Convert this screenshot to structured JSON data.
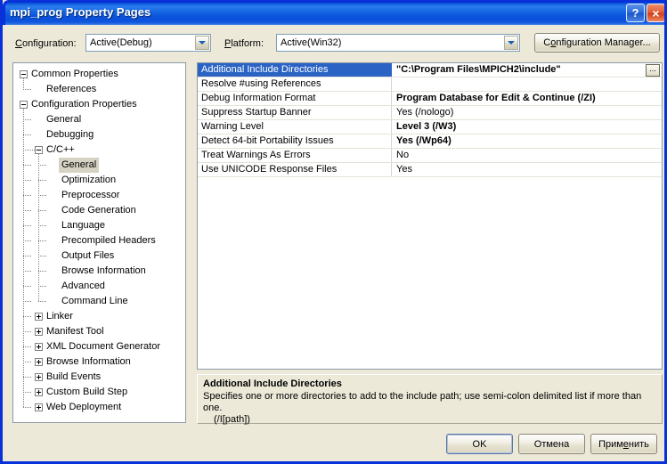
{
  "window": {
    "title": "mpi_prog Property Pages",
    "help_button": "?",
    "close_button": "×"
  },
  "toolbar": {
    "configuration_label": "Configuration:",
    "configuration_label_accel": "C",
    "configuration_value": "Active(Debug)",
    "platform_label": "Platform:",
    "platform_label_accel": "P",
    "platform_value": "Active(Win32)",
    "configuration_manager_label": "Configuration Manager...",
    "configuration_manager_accel": "o"
  },
  "tree": {
    "items": [
      {
        "label": "Common Properties",
        "level": 0,
        "toggle": "minus",
        "selected": false
      },
      {
        "label": "References",
        "level": 1,
        "toggle": "none",
        "selected": false
      },
      {
        "label": "Configuration Properties",
        "level": 0,
        "toggle": "minus",
        "selected": false
      },
      {
        "label": "General",
        "level": 1,
        "toggle": "none",
        "selected": false
      },
      {
        "label": "Debugging",
        "level": 1,
        "toggle": "none",
        "selected": false
      },
      {
        "label": "C/C++",
        "level": 1,
        "toggle": "minus",
        "selected": false
      },
      {
        "label": "General",
        "level": 2,
        "toggle": "none",
        "selected": true
      },
      {
        "label": "Optimization",
        "level": 2,
        "toggle": "none",
        "selected": false
      },
      {
        "label": "Preprocessor",
        "level": 2,
        "toggle": "none",
        "selected": false
      },
      {
        "label": "Code Generation",
        "level": 2,
        "toggle": "none",
        "selected": false
      },
      {
        "label": "Language",
        "level": 2,
        "toggle": "none",
        "selected": false
      },
      {
        "label": "Precompiled Headers",
        "level": 2,
        "toggle": "none",
        "selected": false
      },
      {
        "label": "Output Files",
        "level": 2,
        "toggle": "none",
        "selected": false
      },
      {
        "label": "Browse Information",
        "level": 2,
        "toggle": "none",
        "selected": false
      },
      {
        "label": "Advanced",
        "level": 2,
        "toggle": "none",
        "selected": false
      },
      {
        "label": "Command Line",
        "level": 2,
        "toggle": "none",
        "selected": false
      },
      {
        "label": "Linker",
        "level": 1,
        "toggle": "plus",
        "selected": false
      },
      {
        "label": "Manifest Tool",
        "level": 1,
        "toggle": "plus",
        "selected": false
      },
      {
        "label": "XML Document Generator",
        "level": 1,
        "toggle": "plus",
        "selected": false
      },
      {
        "label": "Browse Information",
        "level": 1,
        "toggle": "plus",
        "selected": false
      },
      {
        "label": "Build Events",
        "level": 1,
        "toggle": "plus",
        "selected": false
      },
      {
        "label": "Custom Build Step",
        "level": 1,
        "toggle": "plus",
        "selected": false
      },
      {
        "label": "Web Deployment",
        "level": 1,
        "toggle": "plus",
        "selected": false
      }
    ]
  },
  "grid": {
    "rows": [
      {
        "name": "Additional Include Directories",
        "value": "\"C:\\Program Files\\MPICH2\\include\"",
        "bold": true,
        "selected": true,
        "ellipsis": true,
        "ellipsis_label": "..."
      },
      {
        "name": "Resolve #using References",
        "value": "",
        "bold": false,
        "selected": false,
        "ellipsis": false
      },
      {
        "name": "Debug Information Format",
        "value": "Program Database for Edit & Continue (/ZI)",
        "bold": true,
        "selected": false,
        "ellipsis": false
      },
      {
        "name": "Suppress Startup Banner",
        "value": "Yes (/nologo)",
        "bold": false,
        "selected": false,
        "ellipsis": false
      },
      {
        "name": "Warning Level",
        "value": "Level 3 (/W3)",
        "bold": true,
        "selected": false,
        "ellipsis": false
      },
      {
        "name": "Detect 64-bit Portability Issues",
        "value": "Yes (/Wp64)",
        "bold": true,
        "selected": false,
        "ellipsis": false
      },
      {
        "name": "Treat Warnings As Errors",
        "value": "No",
        "bold": false,
        "selected": false,
        "ellipsis": false
      },
      {
        "name": "Use UNICODE Response Files",
        "value": "Yes",
        "bold": false,
        "selected": false,
        "ellipsis": false
      }
    ]
  },
  "description": {
    "title": "Additional Include Directories",
    "body": "Specifies one or more directories to add to the include path; use semi-colon delimited list if more than one.",
    "body_second_line": "(/I[path])"
  },
  "footer": {
    "ok_label": "OK",
    "cancel_label": "Отмена",
    "apply_label": "Применить",
    "apply_accel": "е"
  },
  "colors": {
    "title_bar_blue": "#0a50d6",
    "dialog_face": "#ece9d8",
    "selection_blue": "#2a63c4",
    "tree_selection_gray": "#d6d3c4",
    "panel_border": "#8d9aa8",
    "close_red": "#d0401a"
  }
}
